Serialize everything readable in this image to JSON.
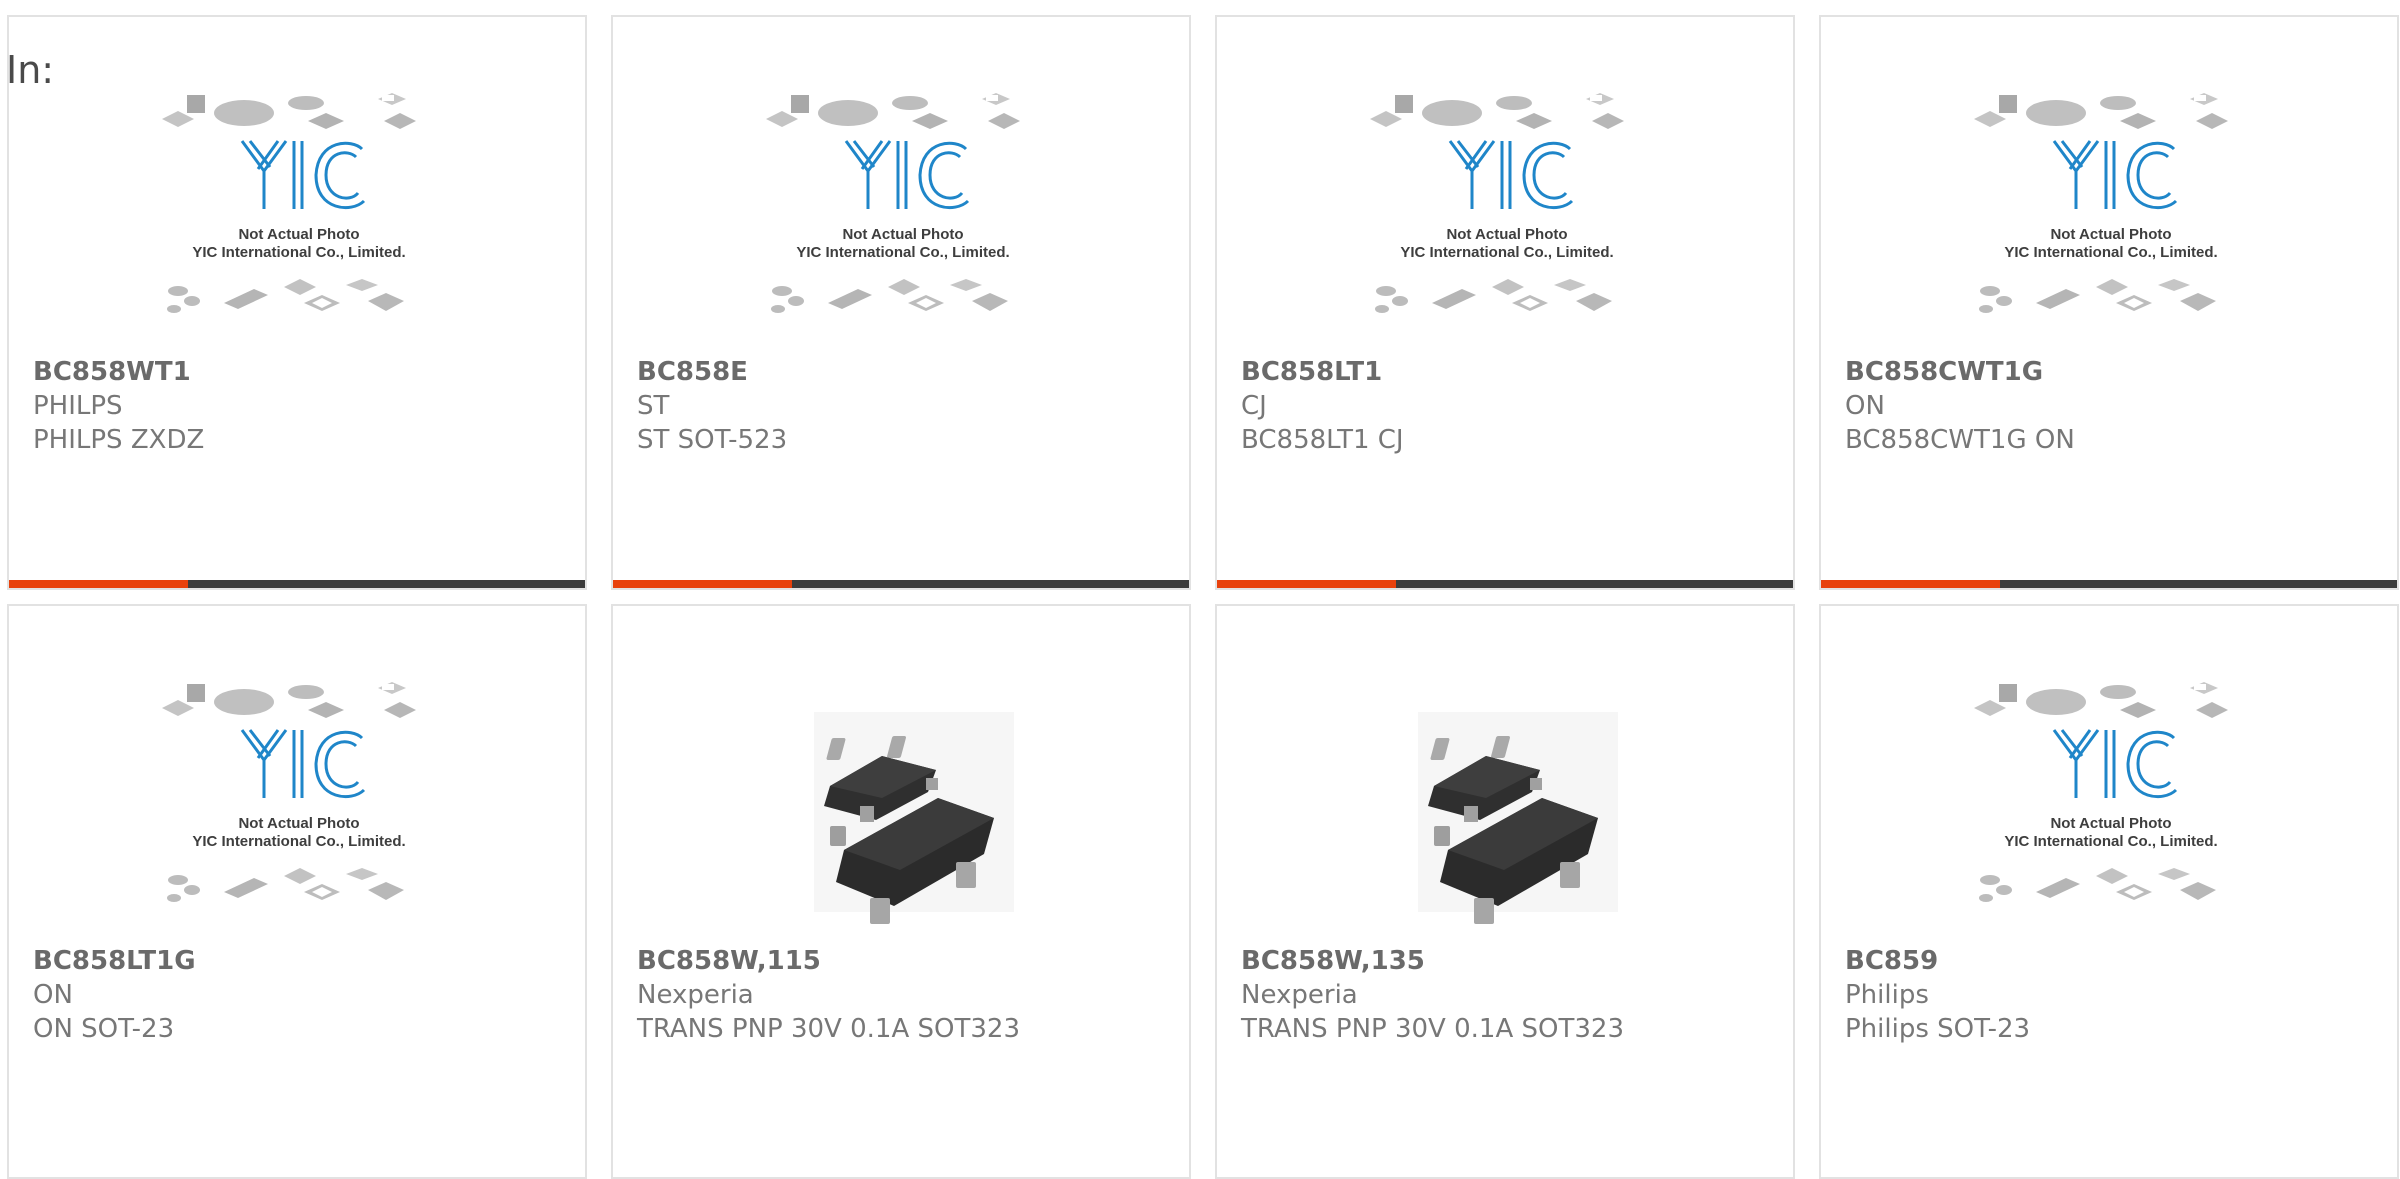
{
  "in_label": "In:",
  "colors": {
    "accent": "#e8410c",
    "bar_dark": "#3c3c3c",
    "card_border": "#e2e2e2",
    "logo": "#1f86c9"
  },
  "placeholder": {
    "line1": "Not Actual Photo",
    "line2": "YIC International Co., Limited.",
    "logo": "YIC"
  },
  "products": [
    {
      "part": "BC858WT1",
      "maker": "PHILPS",
      "desc": "PHILPS ZXDZ",
      "image": "not-actual-photo-placeholder",
      "bar_fill": 0.31
    },
    {
      "part": "BC858E",
      "maker": "ST",
      "desc": "ST SOT-523",
      "image": "not-actual-photo-placeholder",
      "bar_fill": 0.31
    },
    {
      "part": "BC858LT1",
      "maker": "CJ",
      "desc": "BC858LT1 CJ",
      "image": "not-actual-photo-placeholder",
      "bar_fill": 0.31
    },
    {
      "part": "BC858CWT1G",
      "maker": "ON",
      "desc": "BC858CWT1G ON",
      "image": "not-actual-photo-placeholder",
      "bar_fill": 0.31
    },
    {
      "part": "BC858LT1G",
      "maker": "ON",
      "desc": "ON SOT-23",
      "image": "not-actual-photo-placeholder"
    },
    {
      "part": "BC858W,115",
      "maker": "Nexperia",
      "desc": "TRANS PNP 30V 0.1A SOT323",
      "image": "sot323-chip-photo"
    },
    {
      "part": "BC858W,135",
      "maker": "Nexperia",
      "desc": "TRANS PNP 30V 0.1A SOT323",
      "image": "sot323-chip-photo"
    },
    {
      "part": "BC859",
      "maker": "Philips",
      "desc": "Philips SOT-23",
      "image": "not-actual-photo-placeholder"
    }
  ]
}
